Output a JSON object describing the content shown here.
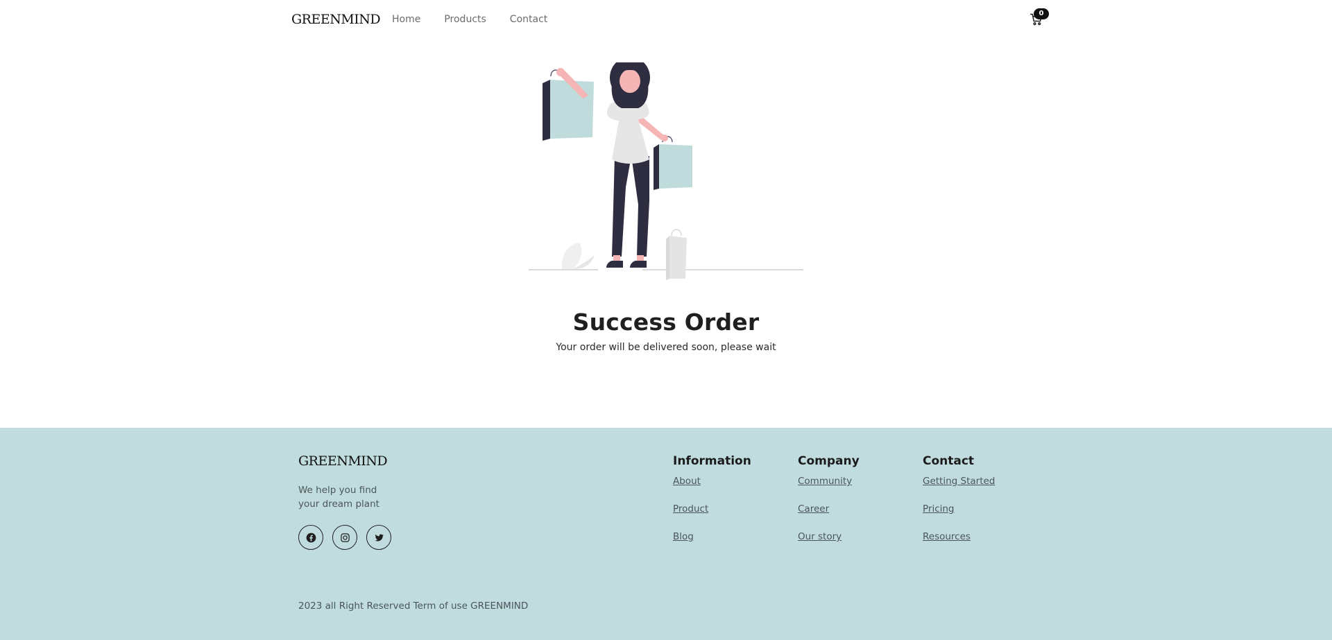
{
  "header": {
    "logo": "GREENMIND",
    "nav": [
      "Home",
      "Products",
      "Contact"
    ],
    "cart_count": "0",
    "cart_icon": "cart-icon"
  },
  "main": {
    "title": "Success Order",
    "subtitle": "Your order will be delivered soon, please wait",
    "illustration": "woman-with-shopping-bags"
  },
  "footer": {
    "logo": "GREENMIND",
    "tagline_line1": "We help you find",
    "tagline_line2": "your dream plant",
    "socials": [
      "facebook-icon",
      "instagram-icon",
      "twitter-icon"
    ],
    "columns": [
      {
        "title": "Information",
        "links": [
          "About",
          "Product",
          "Blog"
        ]
      },
      {
        "title": "Company",
        "links": [
          "Community",
          "Career",
          "Our story"
        ]
      },
      {
        "title": "Contact",
        "links": [
          "Getting Started",
          "Pricing",
          "Resources"
        ]
      }
    ],
    "copyright": "2023 all Right Reserved Term of use GREENMIND"
  },
  "colors": {
    "footer_bg": "#c1dcdf",
    "bag_color": "#bfdbdc",
    "dark": "#2f2e41",
    "skin": "#f6b5b5"
  }
}
